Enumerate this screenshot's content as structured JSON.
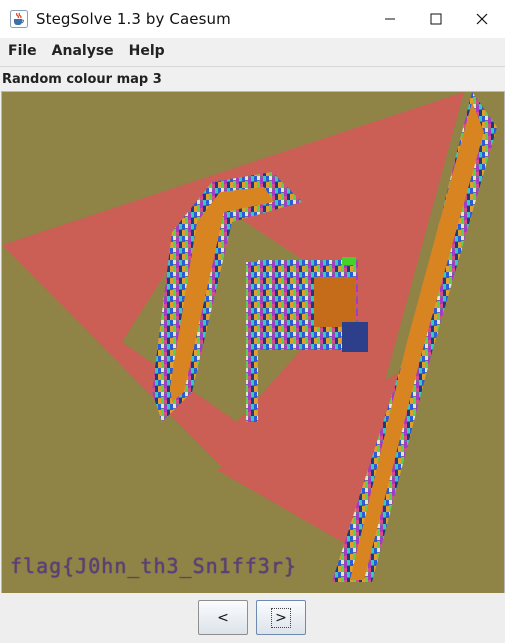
{
  "window": {
    "title": "StegSolve 1.3 by Caesum",
    "icon": "java-cup-icon",
    "controls": {
      "minimize": "—",
      "maximize": "☐",
      "close": "✕"
    }
  },
  "menu": {
    "items": [
      "File",
      "Analyse",
      "Help"
    ]
  },
  "panel": {
    "label": "Random colour map 3"
  },
  "image": {
    "background_color": "#8f8446",
    "overlay_text": "flag{J0hn_th3_Sn1ff3r}"
  },
  "nav": {
    "prev_label": "<",
    "next_label": ">"
  }
}
